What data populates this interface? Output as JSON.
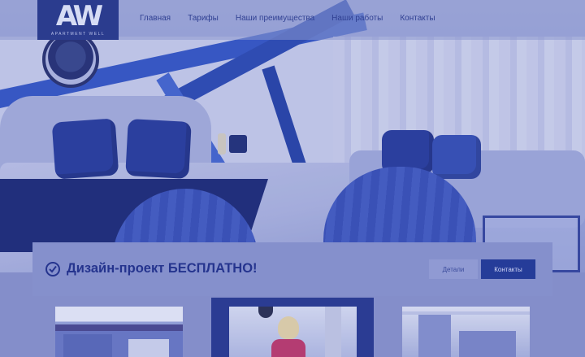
{
  "brand": {
    "logo_mark": "AW",
    "logo_sub": "APARTMENT WELL"
  },
  "nav": {
    "items": [
      "Главная",
      "Тарифы",
      "Наши преимущества",
      "Наши работы",
      "Контакты"
    ]
  },
  "promo": {
    "title": "Дизайн-проект БЕСПЛАТНО!",
    "details_label": "Детали",
    "contacts_label": "Контакты"
  },
  "icons": {
    "promo_icon": "check-circle-icon"
  },
  "colors": {
    "brand_blue": "#233a96",
    "page_tint": "#8d96cc"
  }
}
